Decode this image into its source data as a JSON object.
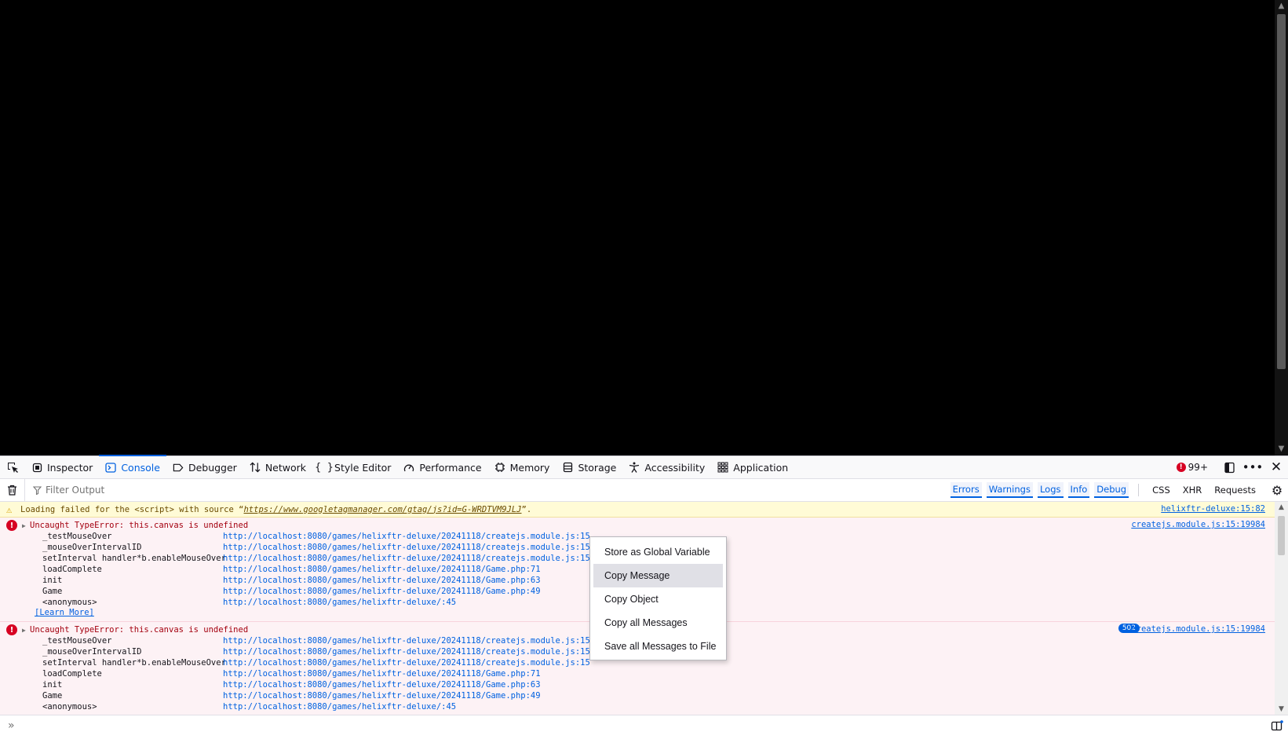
{
  "devtools": {
    "tabs": [
      {
        "label": "Inspector",
        "icon": "inspector-icon"
      },
      {
        "label": "Console",
        "icon": "console-icon"
      },
      {
        "label": "Debugger",
        "icon": "debugger-icon"
      },
      {
        "label": "Network",
        "icon": "network-icon"
      },
      {
        "label": "Style Editor",
        "icon": "style-editor-icon"
      },
      {
        "label": "Performance",
        "icon": "performance-icon"
      },
      {
        "label": "Memory",
        "icon": "memory-icon"
      },
      {
        "label": "Storage",
        "icon": "storage-icon"
      },
      {
        "label": "Accessibility",
        "icon": "accessibility-icon"
      },
      {
        "label": "Application",
        "icon": "application-icon"
      }
    ],
    "selected_tab": "Console",
    "error_count": "99+"
  },
  "filter": {
    "placeholder": "Filter Output",
    "levels": [
      "Errors",
      "Warnings",
      "Logs",
      "Info",
      "Debug"
    ],
    "categories": [
      "CSS",
      "XHR",
      "Requests"
    ]
  },
  "messages": {
    "warning": {
      "prefix": "Loading failed for the <script> with source “",
      "link": "https://www.googletagmanager.com/gtag/js?id=G-WRDTVM9JLJ",
      "suffix": "”.",
      "location": "helixftr-deluxe:15:82"
    },
    "error1": {
      "text": "Uncaught TypeError: this.canvas is undefined",
      "location": "createjs.module.js:15:19984",
      "learn_more": "[Learn More]",
      "frames": [
        {
          "fn": "_testMouseOver",
          "url": "http://localhost:8080/games/helixftr-deluxe/20241118/createjs.module.js:15"
        },
        {
          "fn": "_mouseOverIntervalID",
          "url": "http://localhost:8080/games/helixftr-deluxe/20241118/createjs.module.js:15"
        },
        {
          "fn": "setInterval handler*b.enableMouseOver",
          "url": "http://localhost:8080/games/helixftr-deluxe/20241118/createjs.module.js:15"
        },
        {
          "fn": "loadComplete",
          "url": "http://localhost:8080/games/helixftr-deluxe/20241118/Game.php:71"
        },
        {
          "fn": "init",
          "url": "http://localhost:8080/games/helixftr-deluxe/20241118/Game.php:63"
        },
        {
          "fn": "Game",
          "url": "http://localhost:8080/games/helixftr-deluxe/20241118/Game.php:49"
        },
        {
          "fn": "<anonymous>",
          "url": "http://localhost:8080/games/helixftr-deluxe/:45"
        }
      ]
    },
    "error2": {
      "text": "Uncaught TypeError: this.canvas is undefined",
      "repeat_count": "502",
      "location": "createjs.module.js:15:19984",
      "frames": [
        {
          "fn": "_testMouseOver",
          "url": "http://localhost:8080/games/helixftr-deluxe/20241118/createjs.module.js:15"
        },
        {
          "fn": "_mouseOverIntervalID",
          "url": "http://localhost:8080/games/helixftr-deluxe/20241118/createjs.module.js:15"
        },
        {
          "fn": "setInterval handler*b.enableMouseOver",
          "url": "http://localhost:8080/games/helixftr-deluxe/20241118/createjs.module.js:15"
        },
        {
          "fn": "loadComplete",
          "url": "http://localhost:8080/games/helixftr-deluxe/20241118/Game.php:71"
        },
        {
          "fn": "init",
          "url": "http://localhost:8080/games/helixftr-deluxe/20241118/Game.php:63"
        },
        {
          "fn": "Game",
          "url": "http://localhost:8080/games/helixftr-deluxe/20241118/Game.php:49"
        },
        {
          "fn": "<anonymous>",
          "url": "http://localhost:8080/games/helixftr-deluxe/:45"
        }
      ]
    }
  },
  "context_menu": {
    "items": [
      "Store as Global Variable",
      "Copy Message",
      "Copy Object",
      "Copy all Messages",
      "Save all Messages to File"
    ],
    "highlighted": "Copy Message"
  },
  "colors": {
    "accent": "#0061e0",
    "error_bg": "#fdf2f5",
    "warning_bg": "#fffbd6"
  }
}
